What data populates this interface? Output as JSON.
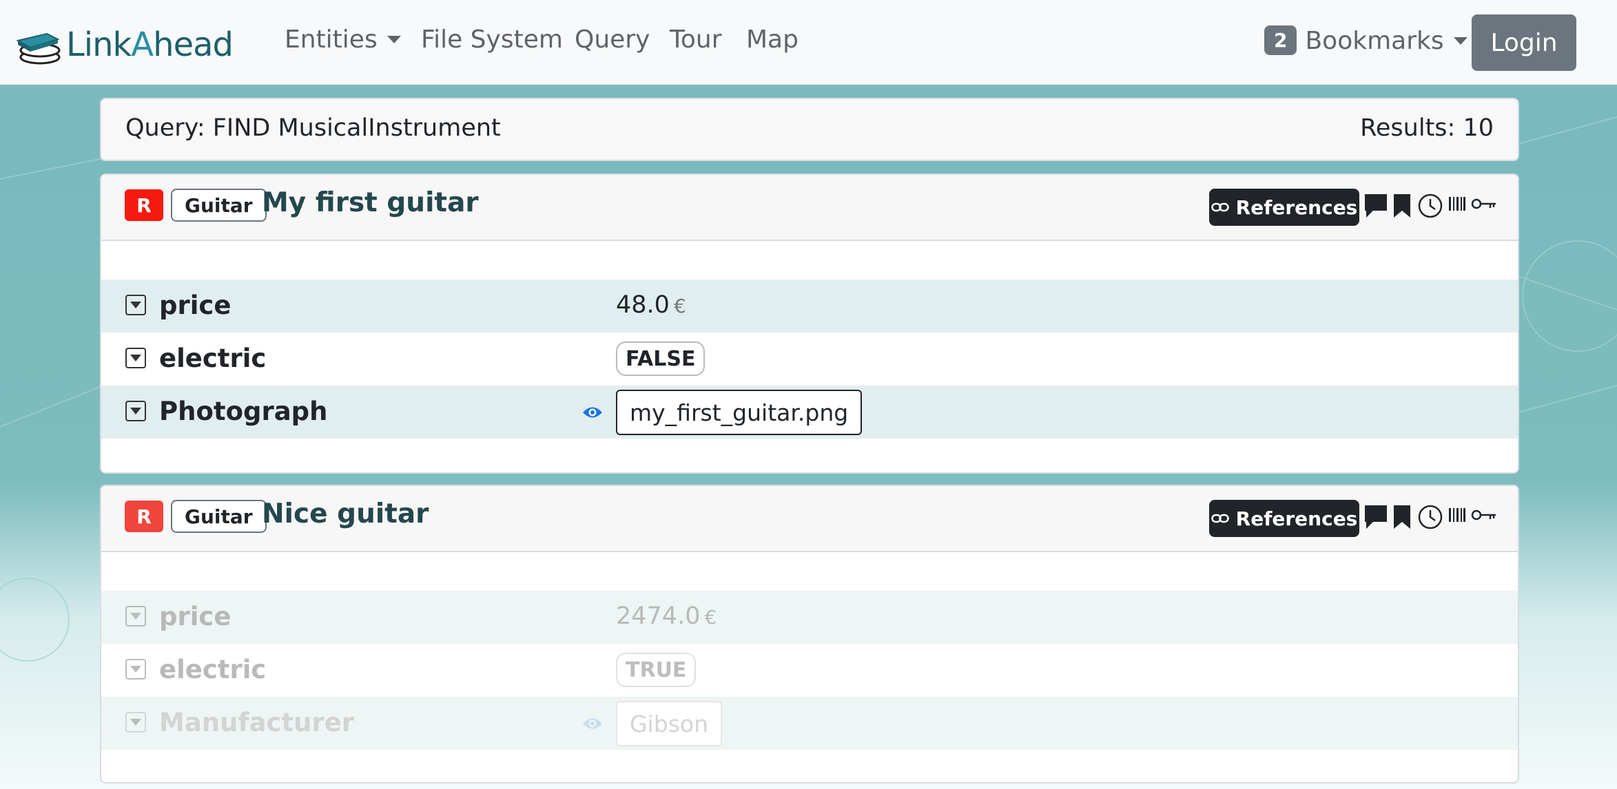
{
  "navbar": {
    "brand": {
      "part1": "Link",
      "part2": "A",
      "part3": "head"
    },
    "items": [
      {
        "label": "Entities",
        "dropdown": true
      },
      {
        "label": "File System"
      },
      {
        "label": "Query"
      },
      {
        "label": "Tour"
      },
      {
        "label": "Map"
      }
    ],
    "bookmarks": {
      "count": "2",
      "label": "Bookmarks"
    },
    "login_label": "Login"
  },
  "query": {
    "text": "Query: FIND MusicalInstrument",
    "results": "Results: 10"
  },
  "entities": [
    {
      "role": "R",
      "type": "Guitar",
      "name": "My first guitar",
      "references_label": "References",
      "properties": [
        {
          "name": "price",
          "value": "48.0",
          "unit": "€"
        },
        {
          "name": "electric",
          "value": "FALSE"
        },
        {
          "name": "Photograph",
          "value": "my_first_guitar.png"
        }
      ]
    },
    {
      "role": "R",
      "type": "Guitar",
      "name": "Nice guitar",
      "references_label": "References",
      "properties": [
        {
          "name": "price",
          "value": "2474.0",
          "unit": "€"
        },
        {
          "name": "electric",
          "value": "TRUE"
        },
        {
          "name": "Manufacturer",
          "value": "Gibson"
        }
      ]
    }
  ],
  "colors": {
    "accent": "#1d5f6c",
    "record_badge": "#f51a10",
    "eye_icon": "#1a73e8",
    "references_button": "#212529"
  },
  "icons": [
    "link-icon",
    "comment-icon",
    "bookmark-icon",
    "history-icon",
    "barcode-icon",
    "key-icon",
    "eye-icon",
    "caret-down-icon"
  ]
}
